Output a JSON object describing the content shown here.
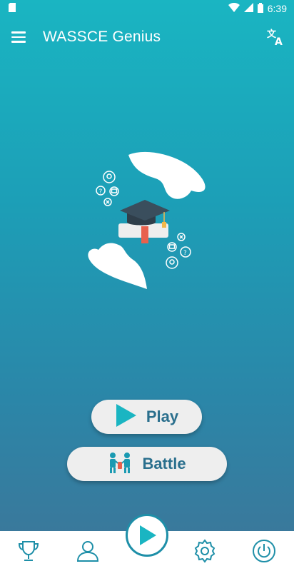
{
  "status_bar": {
    "time": "6:39"
  },
  "app_bar": {
    "title": "WASSCE Genius",
    "menu_icon": "menu-icon",
    "translate_icon": "translate-icon"
  },
  "hero": {
    "icon": "graduation-cap-illustration"
  },
  "buttons": {
    "play": {
      "label": "Play",
      "icon": "play-triangle-icon"
    },
    "battle": {
      "label": "Battle",
      "icon": "battle-people-icon"
    }
  },
  "bottom_nav": {
    "items": [
      "trophy-icon",
      "profile-icon",
      "play-circle-icon",
      "settings-icon",
      "power-icon"
    ]
  },
  "colors": {
    "accent": "#1e8fa8",
    "button_text": "#2a6f8d",
    "button_bg": "#eeeeee",
    "play_icon": "#1ab5c2"
  }
}
